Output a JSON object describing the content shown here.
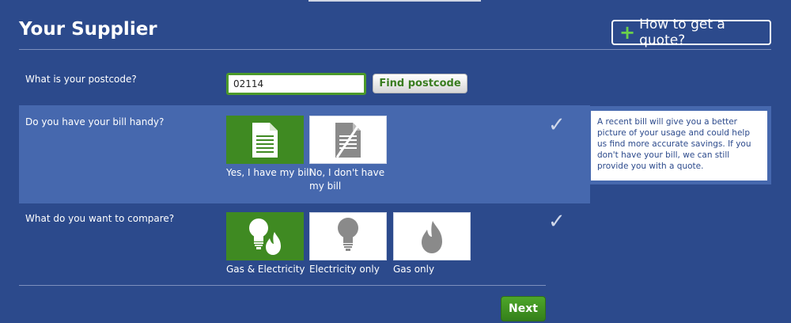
{
  "page": {
    "title": "Your Supplier",
    "quote_button": "How to get a quote?",
    "quote_icon": "plus-icon"
  },
  "postcode": {
    "label": "What is your postcode?",
    "value": "02114",
    "find_button": "Find postcode"
  },
  "bill": {
    "question": "Do you have your bill handy?",
    "options": [
      {
        "label": "Yes, I have my bill",
        "icon": "document-icon",
        "selected": true
      },
      {
        "label": "No, I don't have my bill",
        "icon": "no-document-icon",
        "selected": false
      }
    ],
    "tooltip": "A recent bill will give you a better picture of your usage and could help us find more accurate savings. If you don't have your bill, we can still provide you with a quote."
  },
  "compare": {
    "question": "What do you want to compare?",
    "options": [
      {
        "label": "Gas & Electricity",
        "icon": "bulb-flame-icon",
        "selected": true
      },
      {
        "label": "Electricity only",
        "icon": "bulb-icon",
        "selected": false
      },
      {
        "label": "Gas only",
        "icon": "flame-icon",
        "selected": false
      }
    ]
  },
  "footer": {
    "next_button": "Next"
  },
  "colors": {
    "background": "#2c4a8c",
    "band": "#4668ae",
    "selected": "#3f8a22",
    "accent_green": "#6bd04a"
  }
}
